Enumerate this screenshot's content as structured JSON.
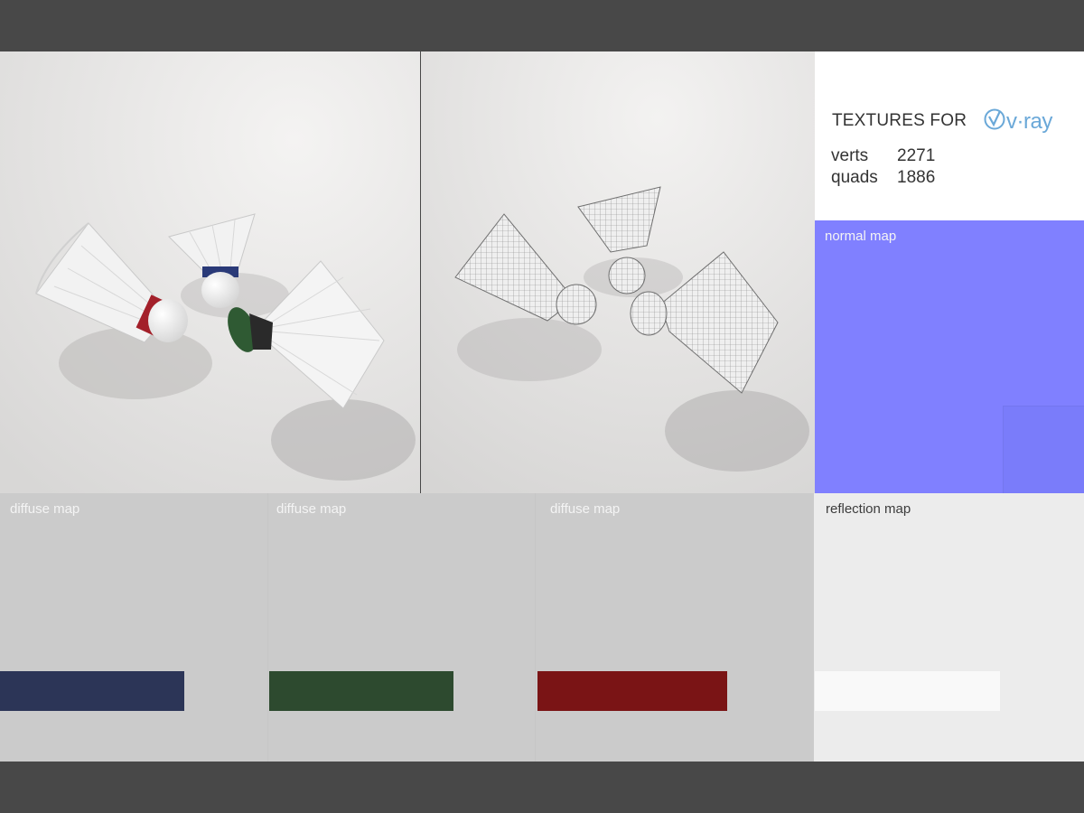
{
  "info": {
    "title": "TEXTURES FOR",
    "logo_text": "v·ray",
    "stats": [
      {
        "label": "verts",
        "value": "2271"
      },
      {
        "label": "quads",
        "value": "1886"
      }
    ]
  },
  "maps": {
    "normal": {
      "label": "normal map",
      "color": "#8080ff"
    },
    "diffuse": [
      {
        "label": "diffuse map",
        "strip_color": "#2c3557"
      },
      {
        "label": "diffuse map",
        "strip_color": "#2d4a2f"
      },
      {
        "label": "diffuse map",
        "strip_color": "#7a1415"
      }
    ],
    "reflection": {
      "label": "reflection map",
      "strip_color": "#f9f9f9"
    }
  },
  "renders": {
    "shaded_bands": [
      "#a3202a",
      "#2a3a78",
      "#2f5a33"
    ],
    "logo_color": "#6aa8d8"
  }
}
